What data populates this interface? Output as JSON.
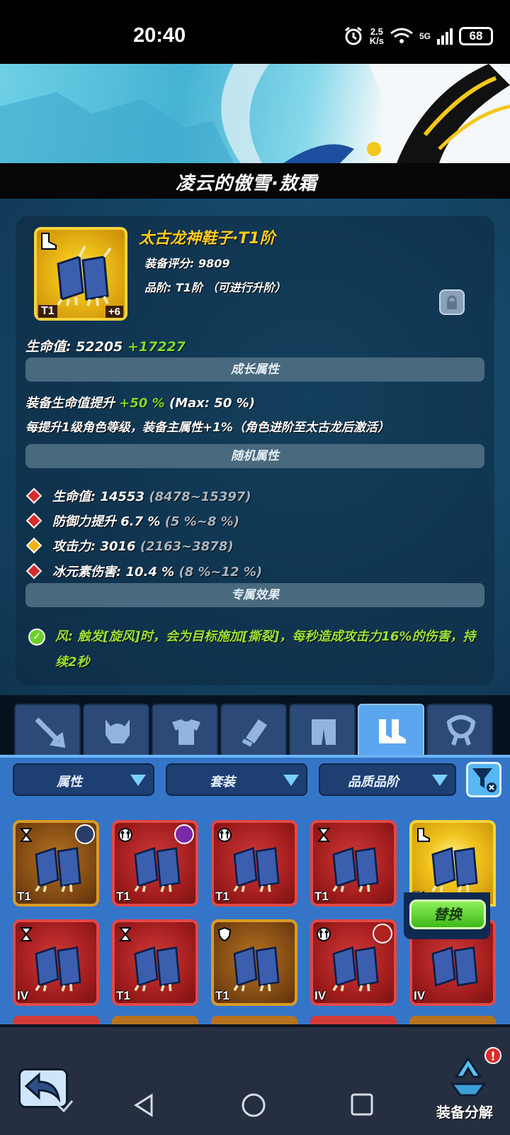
{
  "status_bar": {
    "time": "20:40",
    "net_speed_value": "2.5",
    "net_speed_unit": "K/s",
    "network": "5G",
    "battery": "68"
  },
  "character": {
    "title": "凌云的傲雪·敖霜"
  },
  "equipment": {
    "name": "太古龙神鞋子·T1阶",
    "score_line": "装备评分: 9809",
    "tier_line": "品阶: T1阶 （可进行升阶）",
    "tier_tag": "T1",
    "enhance_tag": "+6",
    "hp_label": "生命值: 52205",
    "hp_bonus": "+17227",
    "growth_head": "成长属性",
    "growth_line1_a": "装备生命值提升",
    "growth_line1_b": "+50 %",
    "growth_line1_c": "(Max: 50 %)",
    "growth_line2": "每提升1级角色等级，装备主属性+1%（角色进阶至太古龙后激活）",
    "random_head": "随机属性",
    "random_attrs": [
      {
        "label": "生命值: 14553",
        "range": "(8478~15397)",
        "gem": "red"
      },
      {
        "label": "防御力提升 6.7 %",
        "range": "(5 %~8 %)",
        "gem": "red"
      },
      {
        "label": "攻击力: 3016",
        "range": "(2163~3878)",
        "gem": "gold"
      },
      {
        "label": "冰元素伤害: 10.4 %",
        "range": "(8 %~12 %)",
        "gem": "red"
      }
    ],
    "exclusive_head": "专属效果",
    "exclusive_text": "风: 触发[旋风]时，会为目标施加[撕裂]，每秒造成攻击力16%的伤害，持续2秒"
  },
  "tabs": [
    "weapon",
    "helmet",
    "armor",
    "bracer",
    "pants",
    "boots",
    "necklace"
  ],
  "filters": {
    "attr": "属性",
    "set": "套装",
    "quality": "品质品阶"
  },
  "inventory": {
    "row1": [
      {
        "lvl": "T1",
        "color": "brown"
      },
      {
        "lvl": "T1",
        "color": "red"
      },
      {
        "lvl": "T1",
        "color": "red"
      },
      {
        "lvl": "T1",
        "color": "red"
      },
      {
        "lvl": "T1",
        "color": "gold"
      }
    ],
    "row2": [
      {
        "lvl": "IV",
        "color": "red"
      },
      {
        "lvl": "T1",
        "color": "red"
      },
      {
        "lvl": "T1",
        "color": "brown"
      },
      {
        "lvl": "IV",
        "color": "red"
      },
      {
        "lvl": "IV",
        "color": "red"
      }
    ],
    "swap_label": "替换"
  },
  "bottom": {
    "disassemble_label": "装备分解",
    "badge": "!"
  }
}
